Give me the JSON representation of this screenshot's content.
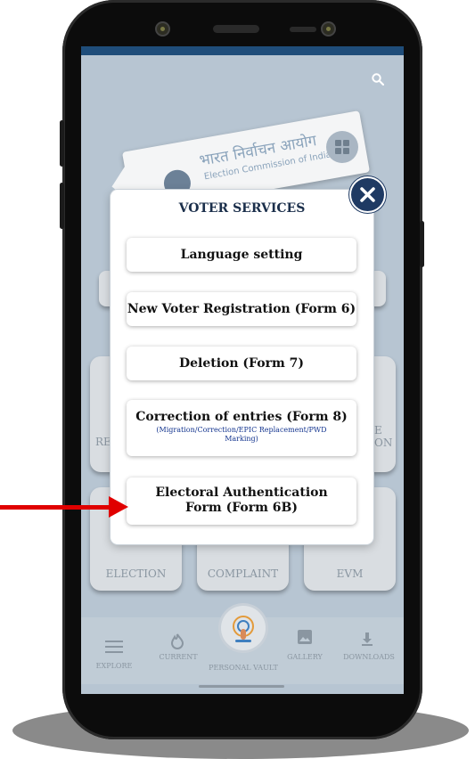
{
  "banner": {
    "hindi_text": "भारत निर्वाचन आयोग",
    "english_text": "Election Commission of India"
  },
  "background_tiles": {
    "row1_left_fragment": "RE",
    "row1_right_fragment_top": "E",
    "row1_right_fragment_bottom": "ON",
    "row2": [
      "ELECTION",
      "COMPLAINT",
      "EVM"
    ]
  },
  "bottom_nav": {
    "items": [
      {
        "label": "EXPLORE",
        "icon": "menu-icon"
      },
      {
        "label": "CURRENT",
        "icon": "flame-icon"
      },
      {
        "label": "PERSONAL VAULT",
        "icon": "fingerprint-icon"
      },
      {
        "label": "GALLERY",
        "icon": "image-icon"
      },
      {
        "label": "DOWNLOADS",
        "icon": "download-icon"
      }
    ]
  },
  "dialog": {
    "title": "VOTER SERVICES",
    "options": [
      {
        "label": "Language setting"
      },
      {
        "label": "New Voter Registration (Form 6)"
      },
      {
        "label": "Deletion (Form 7)"
      },
      {
        "label": "Correction of entries (Form 8)",
        "sublabel": "(Migration/Correction/EPIC Replacement/PWD Marking)"
      },
      {
        "label": "Electoral Authentication Form (Form 6B)"
      }
    ]
  },
  "colors": {
    "accent": "#1f3a63",
    "annotation_arrow": "#e00000",
    "screen_dim": "#b7c5d2"
  },
  "annotation": {
    "type": "arrow",
    "points_to": "Electoral Authentication Form (Form 6B)"
  }
}
